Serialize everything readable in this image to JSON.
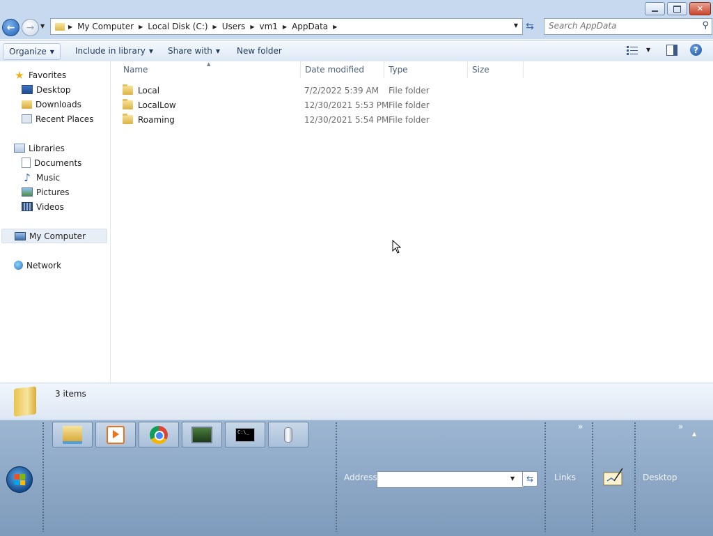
{
  "address": {
    "crumbs": [
      "My Computer",
      "Local Disk (C:)",
      "Users",
      "vm1",
      "AppData"
    ]
  },
  "search": {
    "placeholder": "Search AppData"
  },
  "commands": {
    "organize": "Organize",
    "include_in_library": "Include in library",
    "share_with": "Share with",
    "new_folder": "New folder",
    "help": "?"
  },
  "nav": {
    "favorites": "Favorites",
    "desktop": "Desktop",
    "downloads": "Downloads",
    "recent_places": "Recent Places",
    "libraries": "Libraries",
    "documents": "Documents",
    "music": "Music",
    "pictures": "Pictures",
    "videos": "Videos",
    "my_computer": "My Computer",
    "network": "Network"
  },
  "columns": [
    "Name",
    "Date modified",
    "Type",
    "Size"
  ],
  "files": [
    {
      "name": "Local",
      "date": "7/2/2022 5:39 AM",
      "type": "File folder",
      "size": ""
    },
    {
      "name": "LocalLow",
      "date": "12/30/2021 5:53 PM",
      "type": "File folder",
      "size": ""
    },
    {
      "name": "Roaming",
      "date": "12/30/2021 5:54 PM",
      "type": "File folder",
      "size": ""
    }
  ],
  "details": {
    "count": "3 items"
  },
  "taskbar": {
    "apps": [
      "windows-explorer-icon",
      "media-player-icon",
      "chrome-icon",
      "task-manager-icon",
      "command-prompt-icon",
      "speech-recognition-icon"
    ],
    "cmd_glyph": "C:\\_",
    "address_label": "Address",
    "address_value": "",
    "links_label": "Links",
    "desktop_label": "Desktop"
  },
  "colors": {
    "chrome": "#c6d9ee",
    "taskbar": "#8fa8c6",
    "accent": "#1f5fb4"
  }
}
